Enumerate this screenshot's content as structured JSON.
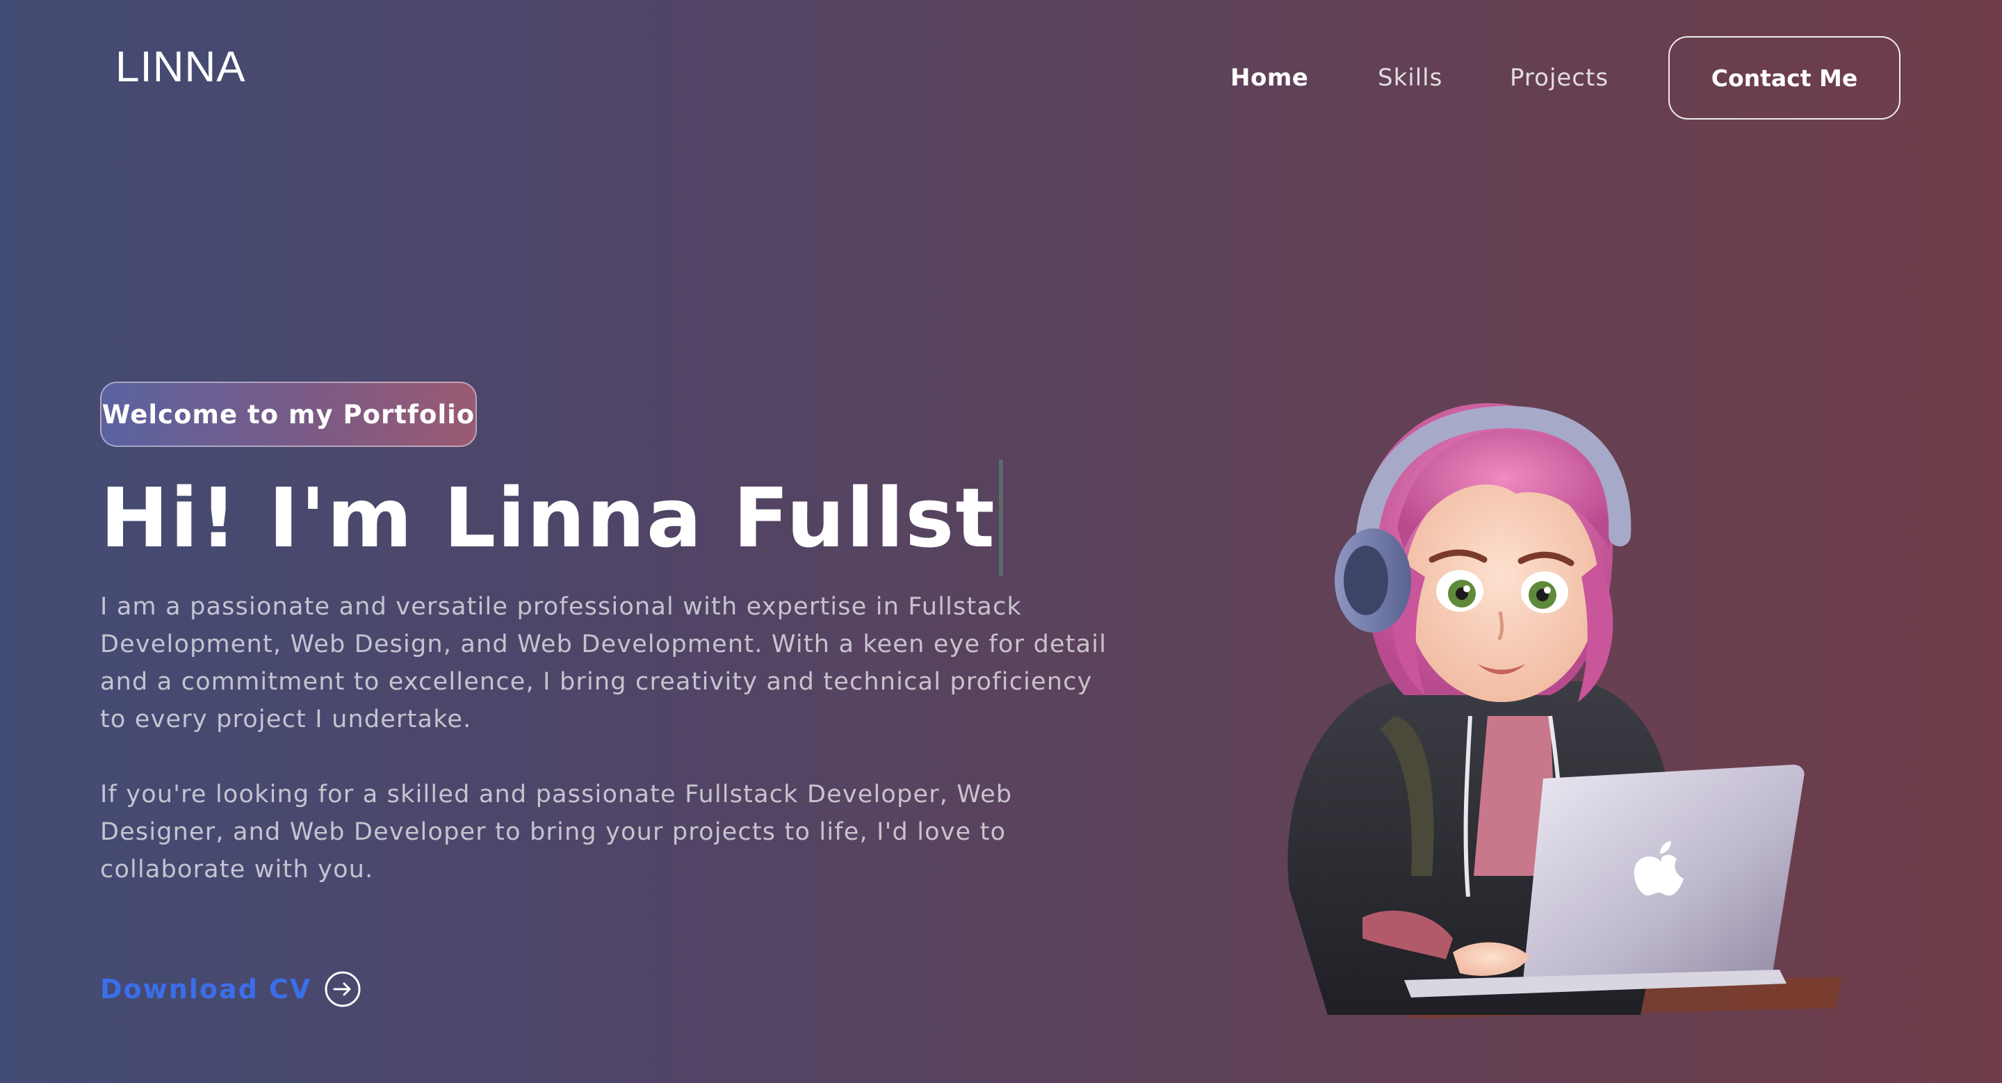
{
  "nav": {
    "logo": "LINNA",
    "links": [
      {
        "label": "Home",
        "active": true
      },
      {
        "label": "Skills",
        "active": false
      },
      {
        "label": "Projects",
        "active": false
      }
    ],
    "contact_label": "Contact Me"
  },
  "hero": {
    "badge": "Welcome to my Portfolio",
    "headline": "Hi! I'm Linna Fullst",
    "paragraph_1": "I am a passionate and versatile professional with expertise in Fullstack Development, Web Design, and Web Development. With a keen eye for detail and a commitment to excellence, I bring creativity and technical proficiency to every project I undertake.",
    "paragraph_2": "If you're looking for a skilled and passionate Fullstack Developer, Web Designer, and Web Developer to bring your projects to life, I'd love to collaborate with you.",
    "download_label": "Download CV",
    "download_icon": "arrow-right-circle-icon"
  },
  "illustration": {
    "icon": "developer-girl-illustration"
  },
  "colors": {
    "accent_link": "#3a6fe8",
    "background_left": "#434c74",
    "background_right": "#6f3d49"
  }
}
